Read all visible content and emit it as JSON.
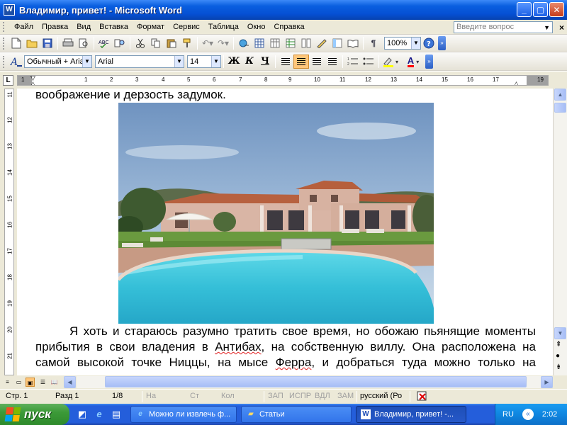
{
  "window": {
    "app_icon": "W",
    "title": "Владимир, привет! - Microsoft Word",
    "minimize": "_",
    "maximize": "▢",
    "close": "✕"
  },
  "menu": {
    "items": [
      "Файл",
      "Правка",
      "Вид",
      "Вставка",
      "Формат",
      "Сервис",
      "Таблица",
      "Окно",
      "Справка"
    ],
    "help_placeholder": "Введите вопрос",
    "close_doc": "×"
  },
  "toolbar_standard": {
    "zoom": "100%"
  },
  "toolbar_format": {
    "style": "Обычный + Aria",
    "font": "Arial",
    "size": "14",
    "bold": "Ж",
    "italic": "К",
    "underline": "Ч",
    "font_color": "A"
  },
  "ruler": {
    "h_numbers": [
      "1",
      "2",
      "1",
      "2",
      "3",
      "4",
      "5",
      "6",
      "7",
      "8",
      "9",
      "10",
      "11",
      "12",
      "13",
      "14",
      "15",
      "16",
      "17",
      "19"
    ],
    "v_numbers": [
      "11",
      "12",
      "13",
      "14",
      "15",
      "16",
      "17",
      "18",
      "19",
      "20",
      "21"
    ]
  },
  "document": {
    "p1": "воображение и дерзость задумок.",
    "p2_a": "Я хоть и стараюсь разумно тратить свое время, но обожаю пьянящие моменты прибытия в свои владения в ",
    "p2_b": "Антибах",
    "p2_c": ", на собственную виллу. Она расположена на самой высокой точке Ниццы, на мысе ",
    "p2_d": "Ферра",
    "p2_e": ", и добраться туда можно только на вертолете."
  },
  "statusbar": {
    "page": "Стр. 1",
    "section": "Разд 1",
    "pages": "1/8",
    "at": "На",
    "line": "Ст",
    "col": "Кол",
    "rec": "ЗАП",
    "trk": "ИСПР",
    "ext": "ВДЛ",
    "ovr": "ЗАМ",
    "lang": "русский (Ро"
  },
  "taskbar": {
    "start": "пуск",
    "tasks": [
      {
        "label": "Можно ли извлечь ф...",
        "icon": "ie-icon"
      },
      {
        "label": "Статьи",
        "icon": "folder-icon"
      },
      {
        "label": "Владимир, привет! -...",
        "icon": "word-icon"
      }
    ],
    "lang": "RU",
    "clock": "2:02"
  }
}
